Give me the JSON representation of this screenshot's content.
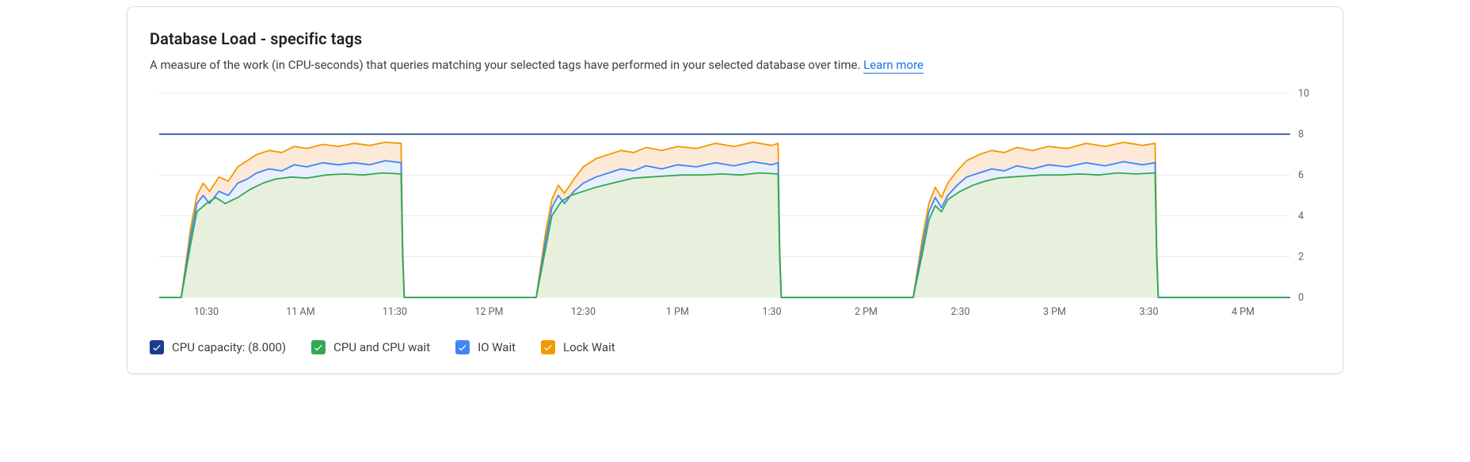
{
  "header": {
    "title": "Database Load - specific tags",
    "subtitle_pre": "A measure of the work (in CPU-seconds) that queries matching your selected tags have performed in your selected database over time. ",
    "learn_more": "Learn more"
  },
  "colors": {
    "cpu_capacity": "#1a3e8c",
    "cpu_wait_fill": "#e6f0dc",
    "cpu_wait_line": "#34a853",
    "io_wait_fill": "#e8f0fe",
    "io_wait_line": "#4285f4",
    "lock_wait_fill": "#fde9d7",
    "lock_wait_line": "#f29900",
    "grid": "#e8eaed",
    "axis_text": "#5f6368"
  },
  "legend": {
    "cpu_capacity": "CPU capacity: (8.000)",
    "cpu_wait": "CPU and CPU wait",
    "io_wait": "IO Wait",
    "lock_wait": "Lock Wait"
  },
  "chart_data": {
    "type": "area",
    "title": "Database Load - specific tags",
    "xlabel": "",
    "ylabel": "",
    "ylim": [
      0,
      10
    ],
    "y_ticks": [
      0,
      2,
      4,
      6,
      8,
      10
    ],
    "x_ticks": [
      "10:30",
      "11 AM",
      "11:30",
      "12 PM",
      "12:30",
      "1 PM",
      "1:30",
      "2 PM",
      "2:30",
      "3 PM",
      "3:30",
      "4 PM"
    ],
    "x_tick_minutes": [
      630,
      660,
      690,
      720,
      750,
      780,
      810,
      840,
      870,
      900,
      930,
      960
    ],
    "x_domain_minutes": [
      615,
      975
    ],
    "cpu_capacity_value": 8.0,
    "series": [
      {
        "name": "CPU and CPU wait",
        "color_line": "#34a853",
        "color_fill": "#e6f0dc",
        "x": [
          615,
          622,
          625,
          627,
          630,
          633,
          636,
          640,
          644,
          648,
          652,
          657,
          662,
          668,
          674,
          680,
          686,
          692,
          692.5,
          693,
          735,
          738,
          740,
          743,
          746,
          750,
          754,
          758,
          762,
          766,
          771,
          776,
          782,
          788,
          794,
          800,
          806,
          812,
          812.5,
          813,
          855,
          858,
          860,
          862,
          864,
          866,
          870,
          874,
          878,
          882,
          886,
          891,
          896,
          902,
          908,
          914,
          920,
          926,
          932,
          932.5,
          933,
          975
        ],
        "y": [
          0,
          0,
          2.6,
          4.2,
          4.6,
          4.9,
          4.6,
          4.9,
          5.3,
          5.6,
          5.8,
          5.9,
          5.85,
          6.0,
          6.05,
          6.0,
          6.1,
          6.05,
          2.0,
          0,
          0,
          2.4,
          4.0,
          4.7,
          5.0,
          5.2,
          5.4,
          5.55,
          5.7,
          5.85,
          5.9,
          5.95,
          6.0,
          6.0,
          6.05,
          6.0,
          6.1,
          6.05,
          2.0,
          0,
          0,
          2.2,
          3.8,
          4.5,
          4.2,
          4.8,
          5.2,
          5.5,
          5.7,
          5.85,
          5.9,
          5.95,
          6.0,
          6.0,
          6.05,
          6.0,
          6.1,
          6.05,
          6.1,
          2.0,
          0,
          0
        ]
      },
      {
        "name": "IO Wait",
        "color_line": "#4285f4",
        "color_fill": "#e8f0fe",
        "x": [
          615,
          622,
          625,
          627,
          629,
          631,
          634,
          637,
          640,
          643,
          646,
          650,
          654,
          658,
          662,
          667,
          672,
          677,
          682,
          687,
          692,
          692.5,
          693,
          735,
          738,
          740,
          742,
          744,
          747,
          750,
          754,
          758,
          762,
          766,
          770,
          775,
          780,
          786,
          792,
          798,
          804,
          810,
          812,
          812.5,
          813,
          855,
          858,
          860,
          862,
          864,
          866,
          869,
          872,
          876,
          880,
          884,
          888,
          893,
          898,
          904,
          910,
          916,
          922,
          928,
          932,
          932.5,
          933,
          975
        ],
        "y": [
          0,
          0,
          3.0,
          4.6,
          5.0,
          4.6,
          5.2,
          5.0,
          5.6,
          5.8,
          6.1,
          6.3,
          6.2,
          6.5,
          6.4,
          6.6,
          6.5,
          6.6,
          6.5,
          6.7,
          6.6,
          2.2,
          0,
          0,
          2.8,
          4.4,
          5.0,
          4.6,
          5.2,
          5.6,
          5.9,
          6.1,
          6.3,
          6.2,
          6.45,
          6.3,
          6.5,
          6.4,
          6.6,
          6.45,
          6.65,
          6.5,
          6.6,
          2.2,
          0,
          0,
          2.6,
          4.2,
          4.9,
          4.4,
          5.0,
          5.5,
          5.9,
          6.1,
          6.3,
          6.2,
          6.45,
          6.3,
          6.5,
          6.4,
          6.6,
          6.45,
          6.65,
          6.5,
          6.6,
          2.2,
          0,
          0
        ]
      },
      {
        "name": "Lock Wait",
        "color_line": "#f29900",
        "color_fill": "#fde9d7",
        "x": [
          615,
          622,
          625,
          627,
          629,
          631,
          634,
          637,
          640,
          643,
          646,
          650,
          654,
          658,
          662,
          667,
          672,
          677,
          682,
          687,
          692,
          692.5,
          693,
          735,
          738,
          740,
          742,
          744,
          747,
          750,
          754,
          758,
          762,
          766,
          770,
          775,
          780,
          786,
          792,
          798,
          804,
          810,
          812,
          812.5,
          813,
          855,
          858,
          860,
          862,
          864,
          866,
          869,
          872,
          876,
          880,
          884,
          888,
          893,
          898,
          904,
          910,
          916,
          922,
          928,
          932,
          932.5,
          933,
          975
        ],
        "y": [
          0,
          0,
          3.4,
          5.0,
          5.6,
          5.2,
          5.9,
          5.7,
          6.4,
          6.7,
          7.0,
          7.2,
          7.1,
          7.4,
          7.3,
          7.5,
          7.4,
          7.55,
          7.45,
          7.6,
          7.55,
          2.4,
          0,
          0,
          3.2,
          4.8,
          5.5,
          5.1,
          5.8,
          6.4,
          6.8,
          7.0,
          7.2,
          7.1,
          7.35,
          7.2,
          7.4,
          7.3,
          7.55,
          7.4,
          7.6,
          7.45,
          7.55,
          2.4,
          0,
          0,
          3.0,
          4.6,
          5.4,
          4.9,
          5.6,
          6.2,
          6.7,
          7.0,
          7.2,
          7.1,
          7.35,
          7.2,
          7.4,
          7.3,
          7.55,
          7.4,
          7.6,
          7.45,
          7.55,
          2.4,
          0,
          0
        ]
      }
    ]
  }
}
